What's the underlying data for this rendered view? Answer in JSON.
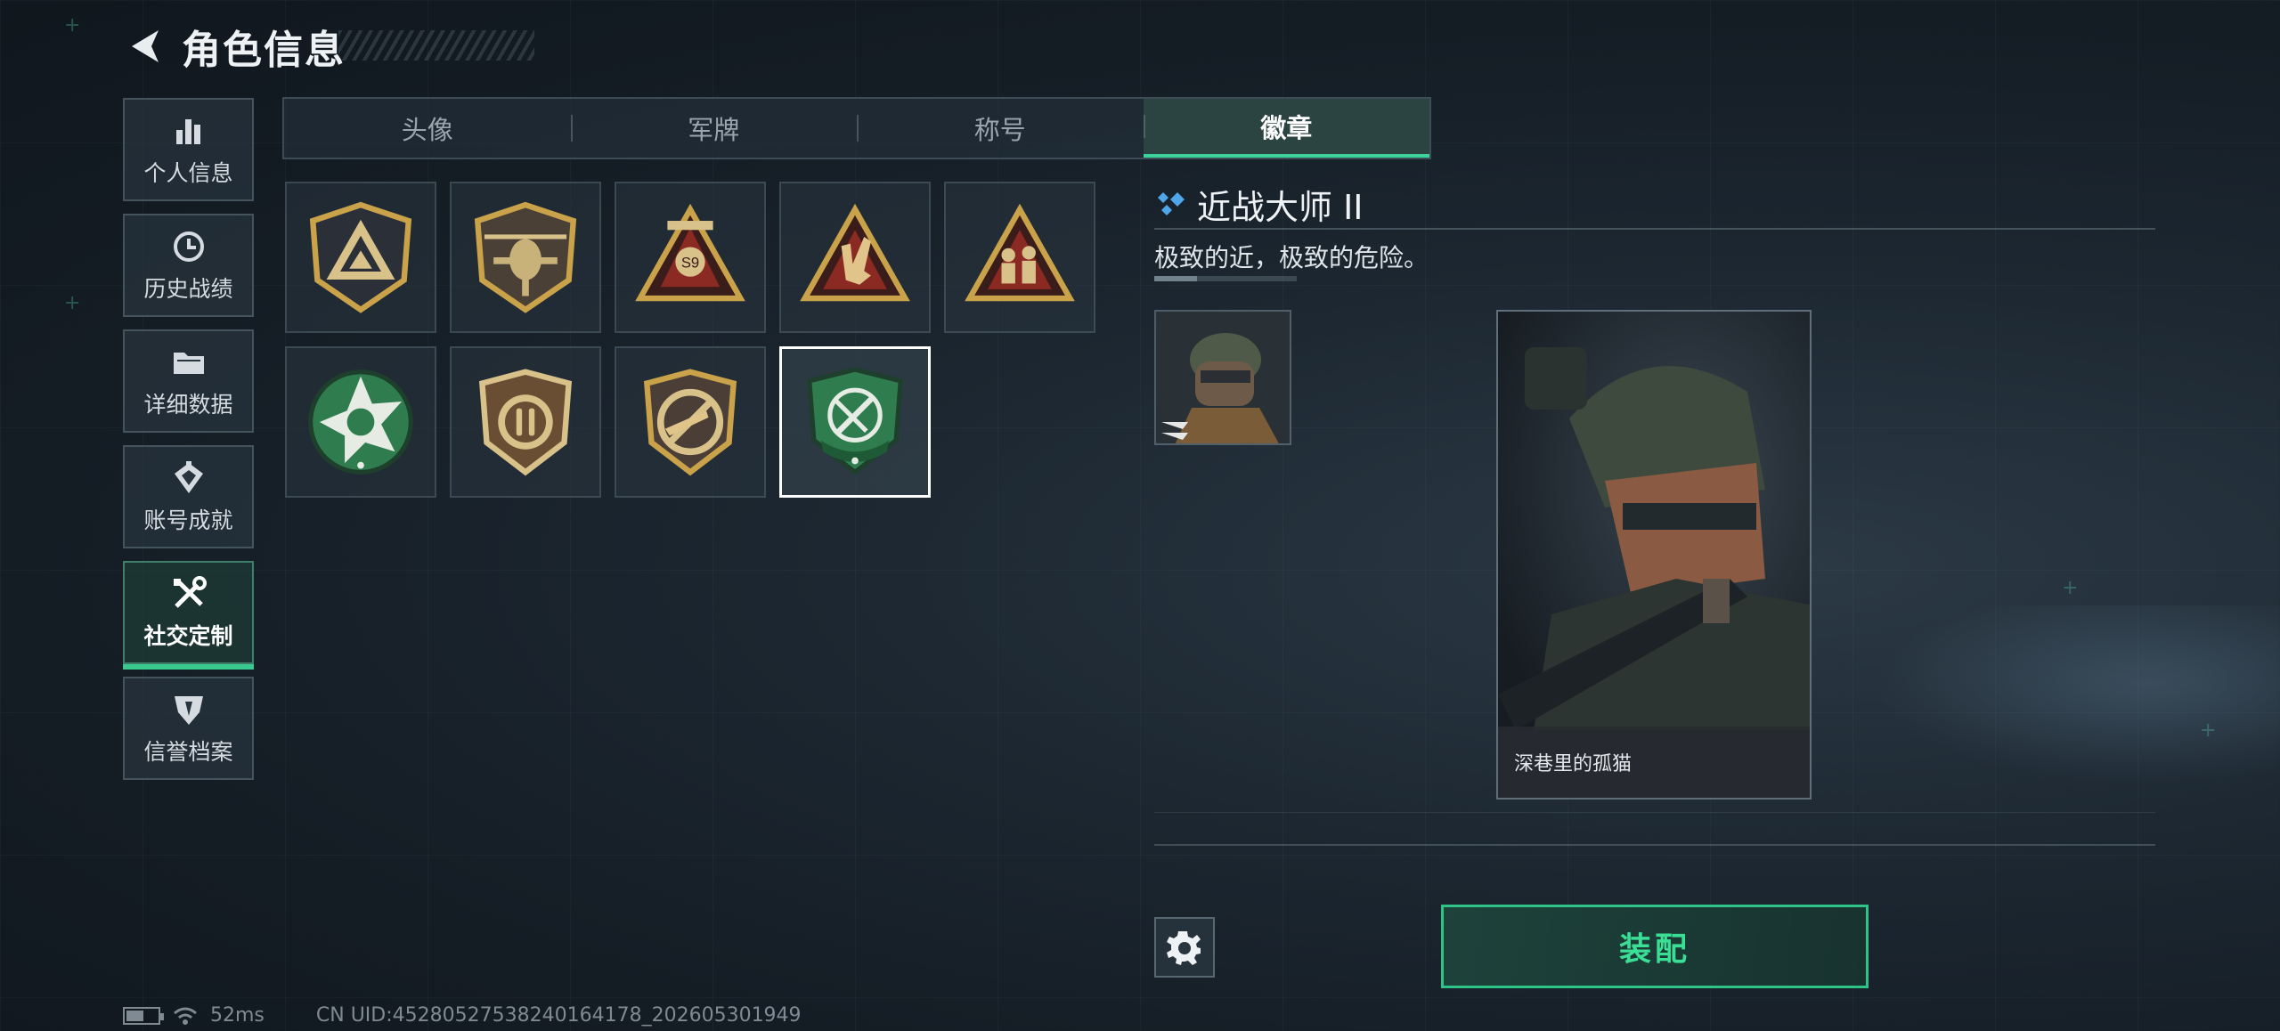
{
  "header": {
    "title": "角色信息",
    "back_icon": "chevron-left-icon"
  },
  "sidebar": {
    "items": [
      {
        "label": "个人信息",
        "icon": "bar-chart-icon",
        "active": false
      },
      {
        "label": "历史战绩",
        "icon": "history-clock-icon",
        "active": false
      },
      {
        "label": "详细数据",
        "icon": "folder-icon",
        "active": false
      },
      {
        "label": "账号成就",
        "icon": "medal-icon",
        "active": false
      },
      {
        "label": "社交定制",
        "icon": "wrench-screwdriver-icon",
        "active": true
      },
      {
        "label": "信誉档案",
        "icon": "credibility-shield-icon",
        "active": false
      }
    ]
  },
  "tabs": [
    {
      "label": "头像",
      "active": false
    },
    {
      "label": "军牌",
      "active": false
    },
    {
      "label": "称号",
      "active": false
    },
    {
      "label": "徽章",
      "active": true
    }
  ],
  "badges": [
    {
      "name": "triangle-emblem-badge",
      "selected": false
    },
    {
      "name": "helicopter-badge",
      "selected": false
    },
    {
      "name": "s9-parachute-badge",
      "selected": false
    },
    {
      "name": "hand-sign-badge",
      "selected": false
    },
    {
      "name": "soldiers-squad-badge",
      "selected": false
    },
    {
      "name": "green-star-badge",
      "selected": false
    },
    {
      "name": "shield-bullets-badge",
      "selected": false
    },
    {
      "name": "rifle-badge",
      "selected": false
    },
    {
      "name": "melee-knife-badge",
      "selected": true
    }
  ],
  "detail": {
    "name": "近战大师 II",
    "description": "极致的近，极致的危险。",
    "progress": 0.3,
    "card_caption": "深巷里的孤猫"
  },
  "actions": {
    "equip_label": "装配",
    "settings_icon": "gear-icon"
  },
  "status": {
    "ping": "52ms",
    "uid": "CN UID:4528052753824016417‌8_202605301949",
    "battery_level": 0.6
  },
  "colors": {
    "accent": "#3adf95",
    "accent_border": "#2fc487",
    "badge_gold": "#c9a24a",
    "badge_green": "#2f7d4f"
  }
}
